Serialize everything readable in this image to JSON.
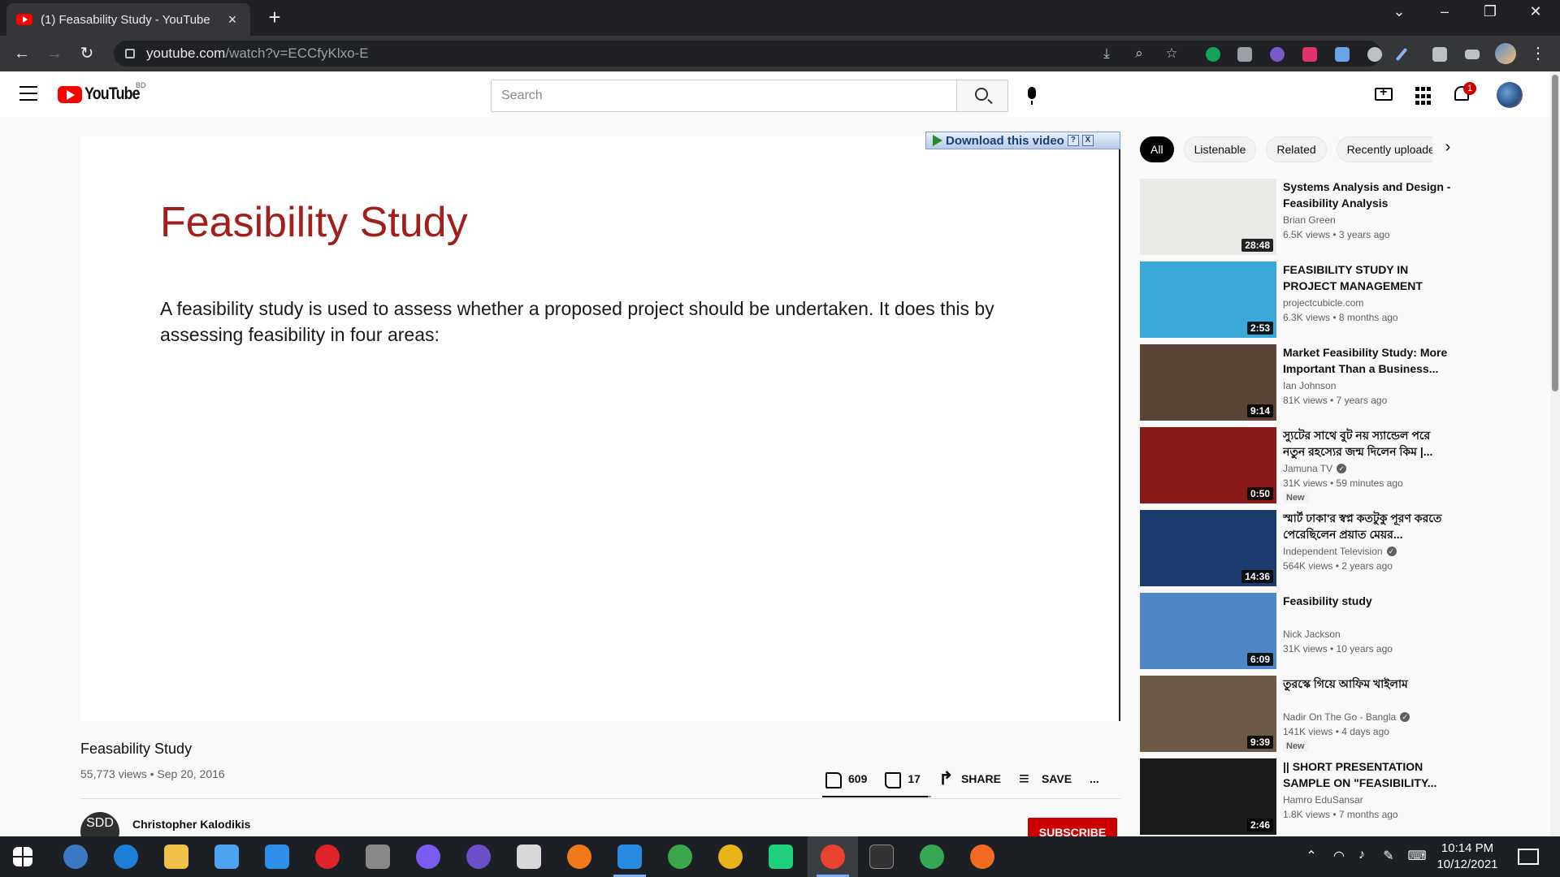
{
  "browser": {
    "tab_title": "(1) Feasability Study - YouTube",
    "url_host": "youtube.com",
    "url_path": "/watch?v=ECCfyKlxo-E"
  },
  "header": {
    "logo_text": "YouTube",
    "country_code": "BD",
    "search_placeholder": "Search",
    "notification_count": "1"
  },
  "video": {
    "download_label": "Download this video",
    "download_help": "?",
    "download_close": "X",
    "slide_title": "Feasibility Study",
    "slide_body": "A feasibility study is used to assess whether a proposed project should be undertaken. It does this by assessing feasibility in four areas:",
    "title": "Feasability Study",
    "meta": "55,773 views • Sep 20, 2016",
    "likes": "609",
    "dislikes": "17",
    "like_ratio": 0.97,
    "share_label": "SHARE",
    "save_label": "SAVE",
    "more_label": "..."
  },
  "channel": {
    "avatar_text": "SDD",
    "name": "Christopher Kalodikis",
    "subscribe_label": "SUBSCRIBE"
  },
  "chips": [
    "All",
    "Listenable",
    "Related",
    "Recently uploaded"
  ],
  "recommendations": [
    {
      "title": "Systems Analysis and Design - Feasibility Analysis",
      "channel": "Brian Green",
      "verified": false,
      "meta": "6.5K views • 3 years ago",
      "duration": "28:48",
      "new": false,
      "thumb": "#eceae6"
    },
    {
      "title": "FEASIBILITY STUDY IN PROJECT MANAGEMENT",
      "channel": "projectcubicle.com",
      "verified": false,
      "meta": "6.3K views • 8 months ago",
      "duration": "2:53",
      "new": false,
      "thumb": "#3aa8d8"
    },
    {
      "title": "Market Feasibility Study: More Important Than a Business...",
      "channel": "Ian Johnson",
      "verified": false,
      "meta": "81K views • 7 years ago",
      "duration": "9:14",
      "new": false,
      "thumb": "#5a4438"
    },
    {
      "title": "স্যুটের সাথে বুট নয় স্যান্ডেল পরে নতুন রহস্যের জন্ম দিলেন কিম |...",
      "channel": "Jamuna TV",
      "verified": true,
      "meta": "31K views • 59 minutes ago",
      "duration": "0:50",
      "new": true,
      "thumb": "#8a1a1a"
    },
    {
      "title": "স্মার্ট ঢাকা'র স্বপ্ন কতটুকু পূরণ করতে পেরেছিলেন প্রয়াত মেয়র...",
      "channel": "Independent Television",
      "verified": true,
      "meta": "564K views • 2 years ago",
      "duration": "14:36",
      "new": false,
      "thumb": "#1d3c6e"
    },
    {
      "title": "Feasibility study",
      "channel": "Nick Jackson",
      "verified": false,
      "meta": "31K views • 10 years ago",
      "duration": "6:09",
      "new": false,
      "thumb": "#4f86c6"
    },
    {
      "title": "তুরস্কে গিয়ে আফিম খাইলাম",
      "channel": "Nadir On The Go - Bangla",
      "verified": true,
      "meta": "141K views • 4 days ago",
      "duration": "9:39",
      "new": true,
      "thumb": "#6b5a48"
    },
    {
      "title": "|| SHORT PRESENTATION SAMPLE ON \"FEASIBILITY...",
      "channel": "Hamro EduSansar",
      "verified": false,
      "meta": "1.8K views • 7 months ago",
      "duration": "2:46",
      "new": false,
      "thumb": "#1a1a1a"
    }
  ],
  "new_badge": "New",
  "taskbar": {
    "time": "10:14 PM",
    "date": "10/12/2021"
  }
}
